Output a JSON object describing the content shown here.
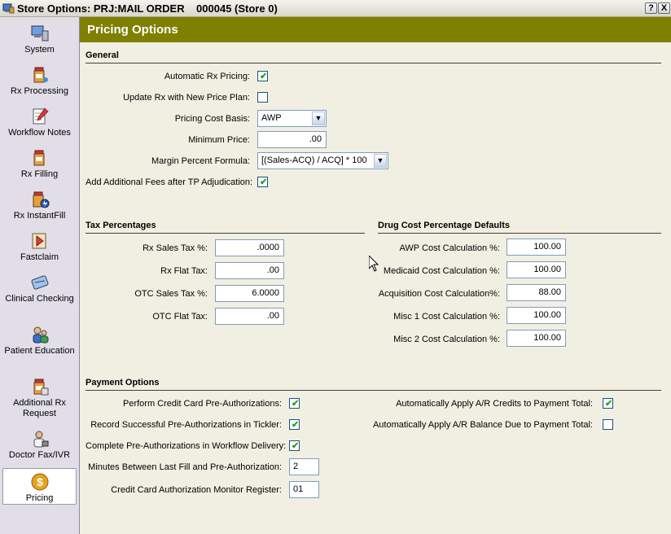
{
  "window": {
    "title": "Store Options: PRJ:MAIL ORDER    000045 (Store 0)",
    "help_label": "?",
    "close_label": "X"
  },
  "sidebar": {
    "items": [
      {
        "label": "System",
        "icon": "computer-icon"
      },
      {
        "label": "Rx Processing",
        "icon": "pill-bottle-icon"
      },
      {
        "label": "Workflow Notes",
        "icon": "notepad-icon"
      },
      {
        "label": "Rx Filling",
        "icon": "pill-bottle-icon"
      },
      {
        "label": "Rx InstantFill",
        "icon": "instantfill-icon"
      },
      {
        "label": "Fastclaim",
        "icon": "claim-icon"
      },
      {
        "label": "Clinical Checking",
        "icon": "clinical-icon"
      },
      {
        "label": "Patient Education",
        "icon": "people-icon"
      },
      {
        "label": "Additional Rx Request",
        "icon": "pill-bottle-icon"
      },
      {
        "label": "Doctor Fax/IVR",
        "icon": "doctor-icon"
      },
      {
        "label": "Pricing",
        "icon": "dollar-coin-icon"
      }
    ],
    "active": "Pricing"
  },
  "header": {
    "title": "Pricing Options"
  },
  "general": {
    "title": "General",
    "automatic_rx_pricing": {
      "label": "Automatic Rx Pricing:",
      "checked": true
    },
    "update_rx_new_price_plan": {
      "label": "Update Rx with New Price Plan:",
      "checked": false
    },
    "pricing_cost_basis": {
      "label": "Pricing Cost Basis:",
      "value": "AWP"
    },
    "minimum_price": {
      "label": "Minimum Price:",
      "value": ".00"
    },
    "margin_percent_formula": {
      "label": "Margin Percent Formula:",
      "value": "[(Sales-ACQ) / ACQ] * 100"
    },
    "add_additional_fees": {
      "label": "Add Additional Fees after TP Adjudication:",
      "checked": true
    }
  },
  "tax": {
    "title": "Tax Percentages",
    "rows": [
      {
        "label": "Rx Sales Tax %:",
        "value": ".0000"
      },
      {
        "label": "Rx Flat Tax:",
        "value": ".00"
      },
      {
        "label": "OTC Sales Tax %:",
        "value": "6.0000"
      },
      {
        "label": "OTC Flat Tax:",
        "value": ".00"
      }
    ]
  },
  "drug_cost": {
    "title": "Drug Cost Percentage Defaults",
    "rows": [
      {
        "label": "AWP Cost Calculation %:",
        "value": "100.00"
      },
      {
        "label": "Medicaid Cost Calculation %:",
        "value": "100.00"
      },
      {
        "label": "Acquisition Cost Calculation%:",
        "value": "88.00"
      },
      {
        "label": "Misc 1 Cost Calculation %:",
        "value": "100.00"
      },
      {
        "label": "Misc 2 Cost Calculation %:",
        "value": "100.00"
      }
    ]
  },
  "payment": {
    "title": "Payment Options",
    "perform_cc_preauth": {
      "label": "Perform Credit Card Pre-Authorizations:",
      "checked": true
    },
    "record_successful_preauth": {
      "label": "Record Successful Pre-Authorizations in Tickler:",
      "checked": true
    },
    "complete_preauth_workflow": {
      "label": "Complete Pre-Authorizations in Workflow Delivery:",
      "checked": true
    },
    "minutes_between": {
      "label": "Minutes Between Last Fill and Pre-Authorization:",
      "value": "2"
    },
    "cc_monitor_register": {
      "label": "Credit Card Authorization Monitor Register:",
      "value": "01"
    },
    "auto_apply_ar_credits": {
      "label": "Automatically Apply A/R Credits to Payment Total:",
      "checked": true
    },
    "auto_apply_ar_balance": {
      "label": "Automatically Apply A/R Balance Due to Payment Total:",
      "checked": false
    }
  },
  "colors": {
    "header_bg": "#7f7f00",
    "sidebar_bg": "#e1dee8",
    "content_bg": "#f1efe2",
    "check_mark": "#21a121"
  }
}
